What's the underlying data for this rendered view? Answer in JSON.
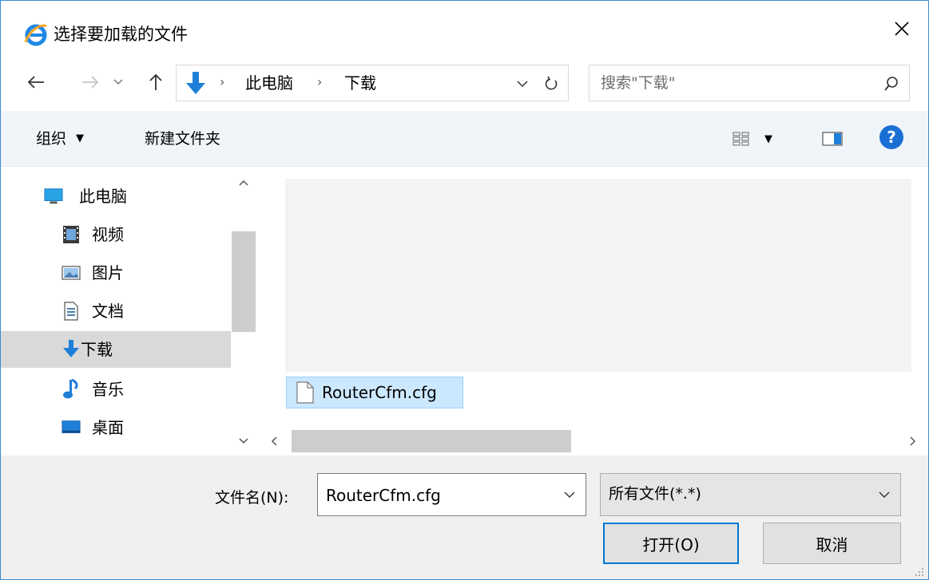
{
  "window": {
    "title": "选择要加载的文件",
    "close_label": "✕"
  },
  "nav": {
    "back_icon": "arrow-left-icon",
    "forward_icon": "arrow-right-icon",
    "recent_icon": "chevron-down-icon",
    "up_icon": "arrow-up-icon"
  },
  "address": {
    "sep": "›",
    "crumbs": [
      "此电脑",
      "下载"
    ],
    "folder_icon": "downloads-arrow-icon"
  },
  "search": {
    "placeholder": "搜索\"下载\""
  },
  "toolbar": {
    "organize_label": "组织",
    "organize_caret": "▼",
    "new_folder_label": "新建文件夹",
    "view_caret": "▼",
    "help_label": "?"
  },
  "sidebar": {
    "items": [
      {
        "label": "此电脑",
        "icon": "this-pc-icon",
        "selected": false
      },
      {
        "label": "视频",
        "icon": "video-icon",
        "selected": false
      },
      {
        "label": "图片",
        "icon": "pictures-icon",
        "selected": false
      },
      {
        "label": "文档",
        "icon": "documents-icon",
        "selected": false
      },
      {
        "label": "下载",
        "icon": "downloads-icon",
        "selected": true
      },
      {
        "label": "音乐",
        "icon": "music-icon",
        "selected": false
      },
      {
        "label": "桌面",
        "icon": "desktop-icon",
        "selected": false
      }
    ]
  },
  "files": {
    "items": [
      {
        "name": "RouterCfm.cfg",
        "icon": "file-icon",
        "selected": true
      }
    ]
  },
  "bottom": {
    "filename_label": "文件名(N):",
    "filename_value": "RouterCfm.cfg",
    "filetype_value": "所有文件(*.*)",
    "open_label": "打开(O)",
    "cancel_label": "取消"
  },
  "colors": {
    "accent": "#0078d7",
    "selection": "#cce8ff",
    "toolbar_bg": "#f0f5fa",
    "footer_bg": "#f0f0f0"
  }
}
